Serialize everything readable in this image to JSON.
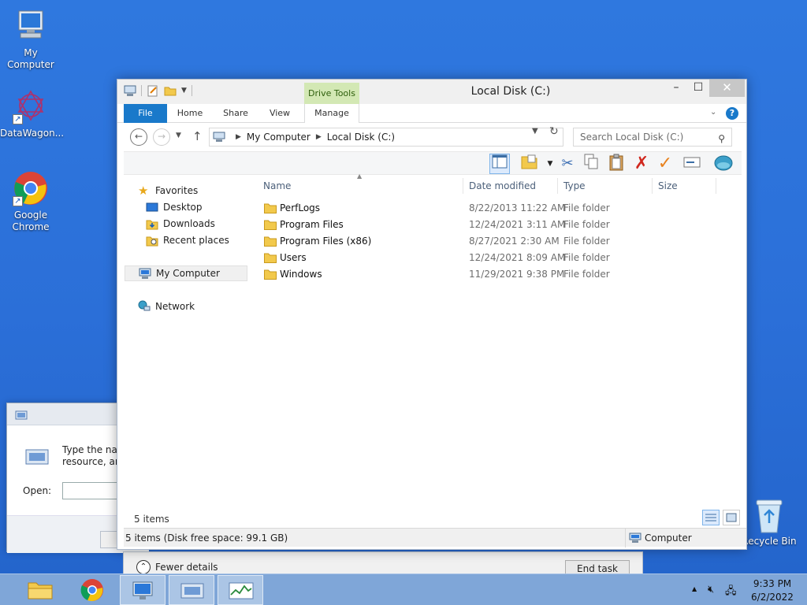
{
  "desktop": {
    "icons": [
      {
        "label": "My Computer"
      },
      {
        "label": "DataWagon..."
      },
      {
        "label_line1": "Google",
        "label_line2": "Chrome"
      },
      {
        "label": "Recycle Bin"
      }
    ]
  },
  "run_dialog": {
    "text_line1": "Type the nam",
    "text_line2": "resource, and",
    "open_label": "Open:"
  },
  "task_manager": {
    "fewer_details": "Fewer details",
    "end_task": "End task"
  },
  "explorer": {
    "title": "Local Disk (C:)",
    "context_tab_group": "Drive Tools",
    "ribbon_tabs": [
      "File",
      "Home",
      "Share",
      "View",
      "Manage"
    ],
    "help_glyph": "?",
    "address": {
      "crumbs": [
        "My Computer",
        "Local Disk (C:)"
      ]
    },
    "search": {
      "placeholder": "Search Local Disk (C:)"
    },
    "nav": {
      "favorites": "Favorites",
      "desktop": "Desktop",
      "downloads": "Downloads",
      "recent": "Recent places",
      "my_computer": "My Computer",
      "network": "Network"
    },
    "columns": [
      "Name",
      "Date modified",
      "Type",
      "Size"
    ],
    "files": [
      {
        "name": "PerfLogs",
        "date": "8/22/2013 11:22 AM",
        "type": "File folder"
      },
      {
        "name": "Program Files",
        "date": "12/24/2021 3:11 AM",
        "type": "File folder"
      },
      {
        "name": "Program Files (x86)",
        "date": "8/27/2021 2:30 AM",
        "type": "File folder"
      },
      {
        "name": "Users",
        "date": "12/24/2021 8:09 AM",
        "type": "File folder"
      },
      {
        "name": "Windows",
        "date": "11/29/2021 9:38 PM",
        "type": "File folder"
      }
    ],
    "items_count": "5 items",
    "status_left": "5 items (Disk free space: 99.1 GB)",
    "status_right": "Computer"
  },
  "taskbar": {
    "time": "9:33 PM",
    "date": "6/2/2022"
  },
  "colors": {
    "file_tab": "#1979ca",
    "drive_tools": "#d3e8b4",
    "folder": "#f2c94c"
  }
}
